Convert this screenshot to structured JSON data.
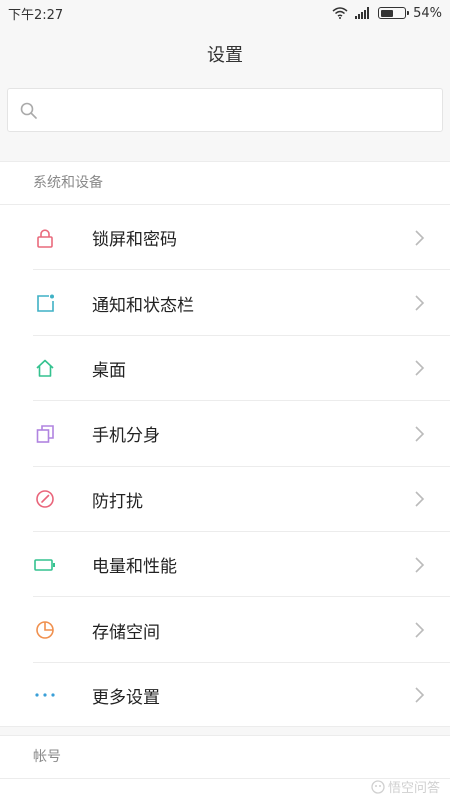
{
  "status": {
    "time": "下午2:27",
    "battery": "54%",
    "battery_level": 0.54
  },
  "header": {
    "title": "设置"
  },
  "search": {
    "placeholder": ""
  },
  "sections": [
    {
      "title": "系统和设备",
      "items": [
        {
          "label": "锁屏和密码",
          "icon": "lock-icon",
          "color": "#e96a7c"
        },
        {
          "label": "通知和状态栏",
          "icon": "notification-icon",
          "color": "#3fb1c5"
        },
        {
          "label": "桌面",
          "icon": "home-icon",
          "color": "#34c28f"
        },
        {
          "label": "手机分身",
          "icon": "clone-icon",
          "color": "#b084e0"
        },
        {
          "label": "防打扰",
          "icon": "do-not-disturb-icon",
          "color": "#e9647a"
        },
        {
          "label": "电量和性能",
          "icon": "battery-icon",
          "color": "#34c28f"
        },
        {
          "label": "存储空间",
          "icon": "storage-pie-icon",
          "color": "#f0904e"
        },
        {
          "label": "更多设置",
          "icon": "more-dots-icon",
          "color": "#3a9fd8"
        }
      ]
    },
    {
      "title": "帐号"
    }
  ],
  "watermark": {
    "text": "悟空问答"
  }
}
